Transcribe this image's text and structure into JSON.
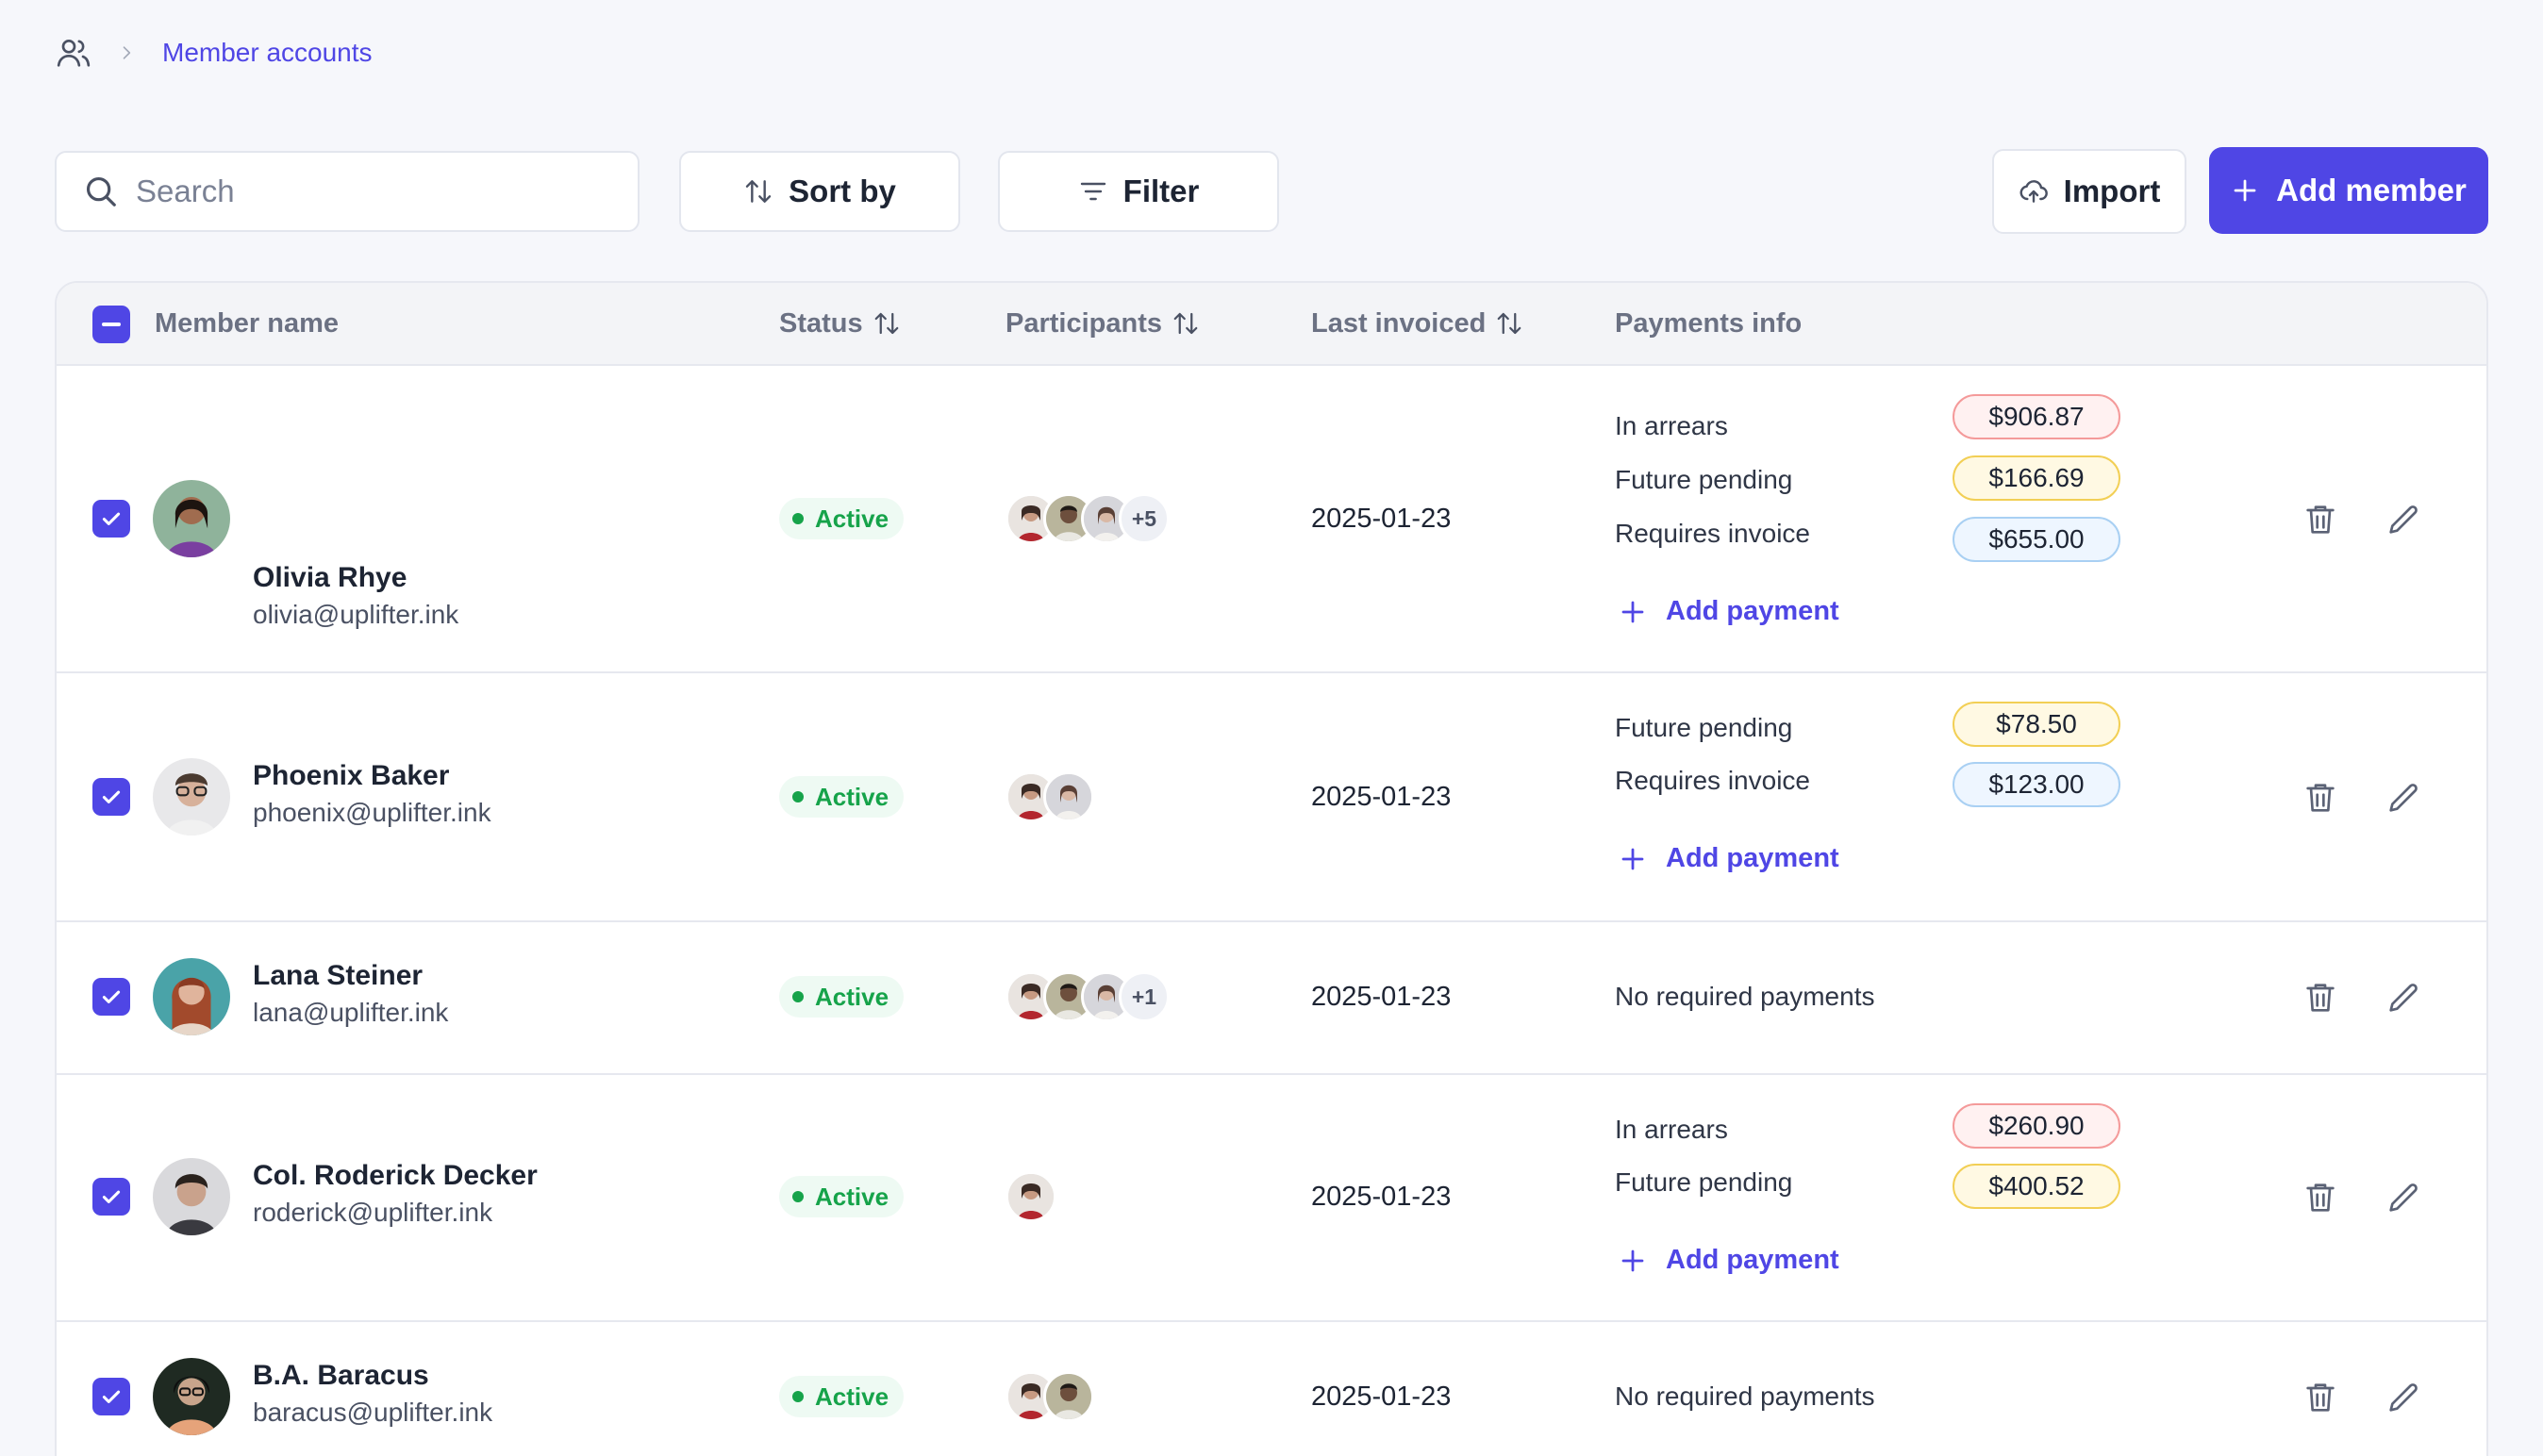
{
  "breadcrumb": {
    "current": "Member accounts"
  },
  "toolbar": {
    "search_placeholder": "Search",
    "sort_label": "Sort by",
    "filter_label": "Filter",
    "import_label": "Import",
    "add_member_label": "Add member"
  },
  "colors": {
    "accent": "#4f46e5",
    "active": "#16a34a",
    "arrears": "#f49a9a",
    "pending": "#f2cf55",
    "invoice": "#a9d0f3"
  },
  "table": {
    "columns": {
      "name": "Member name",
      "status": "Status",
      "participants": "Participants",
      "last_invoiced": "Last invoiced",
      "payments": "Payments info"
    },
    "add_payment_label": "Add payment",
    "no_payments_label": "No required payments",
    "rows": [
      {
        "name": "Olivia Rhye",
        "email": "olivia@uplifter.ink",
        "status": "Active",
        "participants_more": "+5",
        "last_invoiced": "2025-01-23",
        "payments": [
          {
            "label": "In arrears",
            "amount": "$906.87"
          },
          {
            "label": "Future pending",
            "amount": "$166.69"
          },
          {
            "label": "Requires invoice",
            "amount": "$655.00"
          }
        ]
      },
      {
        "name": "Phoenix Baker",
        "email": "phoenix@uplifter.ink",
        "status": "Active",
        "last_invoiced": "2025-01-23",
        "payments": [
          {
            "label": "Future pending",
            "amount": "$78.50"
          },
          {
            "label": "Requires invoice",
            "amount": "$123.00"
          }
        ]
      },
      {
        "name": "Lana Steiner",
        "email": "lana@uplifter.ink",
        "status": "Active",
        "participants_more": "+1",
        "last_invoiced": "2025-01-23"
      },
      {
        "name": "Col. Roderick Decker",
        "email": "roderick@uplifter.ink",
        "status": "Active",
        "last_invoiced": "2025-01-23",
        "payments": [
          {
            "label": "In arrears",
            "amount": "$260.90"
          },
          {
            "label": "Future pending",
            "amount": "$400.52"
          }
        ]
      },
      {
        "name": "B.A. Baracus",
        "email": "baracus@uplifter.ink",
        "status": "Active",
        "last_invoiced": "2025-01-23"
      }
    ]
  }
}
